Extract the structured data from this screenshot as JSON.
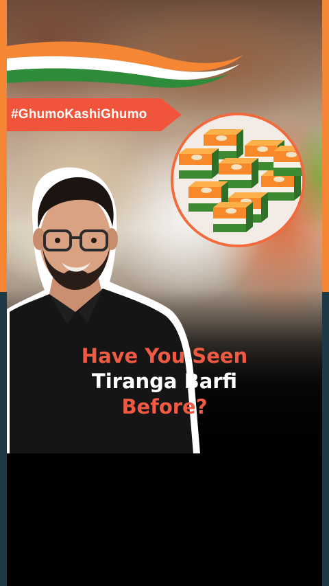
{
  "hashtag": "#GhumoKashiGhumo",
  "headline": {
    "line1": "Have You Seen",
    "line2": "Tiranga Barfi",
    "line3": "Before?"
  },
  "colors": {
    "accent_orange": "#f58634",
    "ribbon_red": "#f0553c",
    "headline_red": "#f05a42",
    "headline_white": "#ffffff",
    "bottom_bar_teal": "#1e3a46",
    "flag_saffron": "#f58634",
    "flag_green": "#2e8b3a"
  },
  "icons": {
    "flag_swoosh": "indian-tricolor-swoosh-icon"
  }
}
